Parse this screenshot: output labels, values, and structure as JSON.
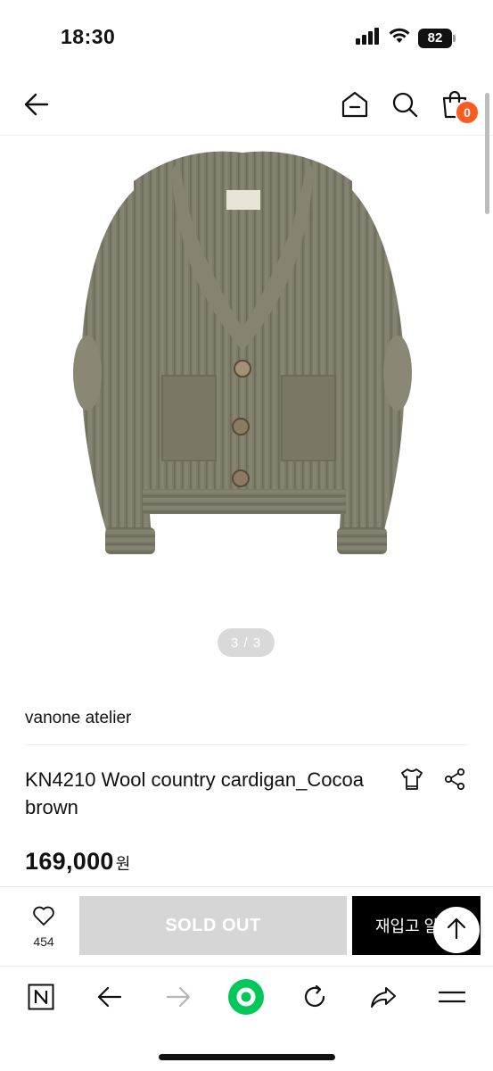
{
  "status_bar": {
    "time": "18:30",
    "battery": "82",
    "icons": [
      "signal-icon",
      "wifi-icon",
      "battery-icon"
    ]
  },
  "header": {
    "icons": [
      "back-arrow-icon",
      "home-icon",
      "search-icon",
      "shopping-bag-icon"
    ],
    "cart_count": "0",
    "badge_color": "#ff5a1f"
  },
  "gallery": {
    "counter": "3 / 3",
    "current": 3,
    "total": 3
  },
  "product": {
    "brand": "vanone atelier",
    "title": "KN4210 Wool country cardigan_Cocoa brown",
    "price": "169,000",
    "currency": "원",
    "action_icons": [
      "size-guide-shirt-icon",
      "share-icon"
    ]
  },
  "actions": {
    "like_count": "454",
    "sold_out_label": "SOLD OUT",
    "restock_label": "재입고 알림",
    "icons": [
      "heart-icon",
      "arrow-up-icon"
    ]
  },
  "browser_toolbar": {
    "icons": [
      "naver-n-icon",
      "back-icon",
      "forward-icon",
      "green-dot-icon",
      "refresh-icon",
      "share-arrow-icon",
      "menu-icon"
    ],
    "accent": "#03c75a"
  }
}
